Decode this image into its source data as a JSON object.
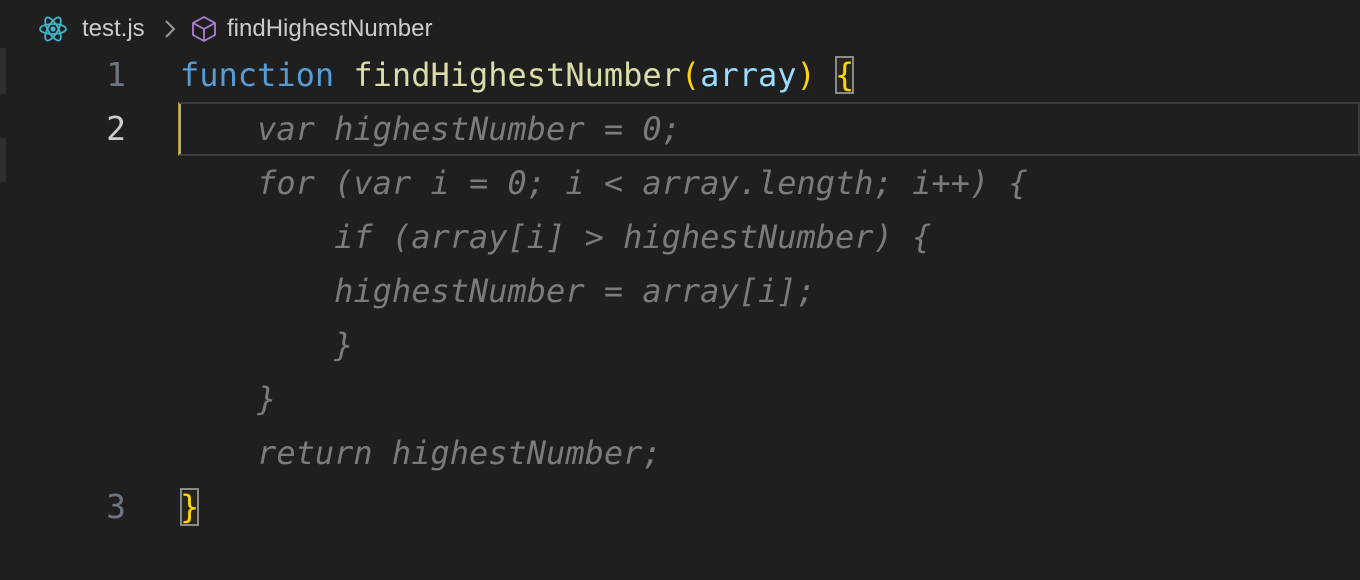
{
  "breadcrumb": {
    "file": "test.js",
    "symbol": "findHighestNumber",
    "file_icon": "react-icon",
    "symbol_icon": "cube-icon"
  },
  "gutter": {
    "line_1": "1",
    "line_2": "2",
    "line_3": "3"
  },
  "code": {
    "line1": {
      "keyword": "function",
      "name": "findHighestNumber",
      "open_paren": "(",
      "param": "array",
      "close_paren": ")",
      "open_brace": "{"
    },
    "ghost_lines": [
      "    var highestNumber = 0;",
      "    for (var i = 0; i < array.length; i++) {",
      "        if (array[i] > highestNumber) {",
      "        highestNumber = array[i];",
      "        }",
      "    }",
      "    return highestNumber;"
    ],
    "line3": {
      "close_brace": "}"
    }
  },
  "colors": {
    "background": "#1f1f1f",
    "keyword": "#569cd6",
    "function": "#dcdcaa",
    "parameter": "#9cdcfe",
    "bracket": "#ffd700",
    "ghost_text": "#7b7b7b"
  }
}
